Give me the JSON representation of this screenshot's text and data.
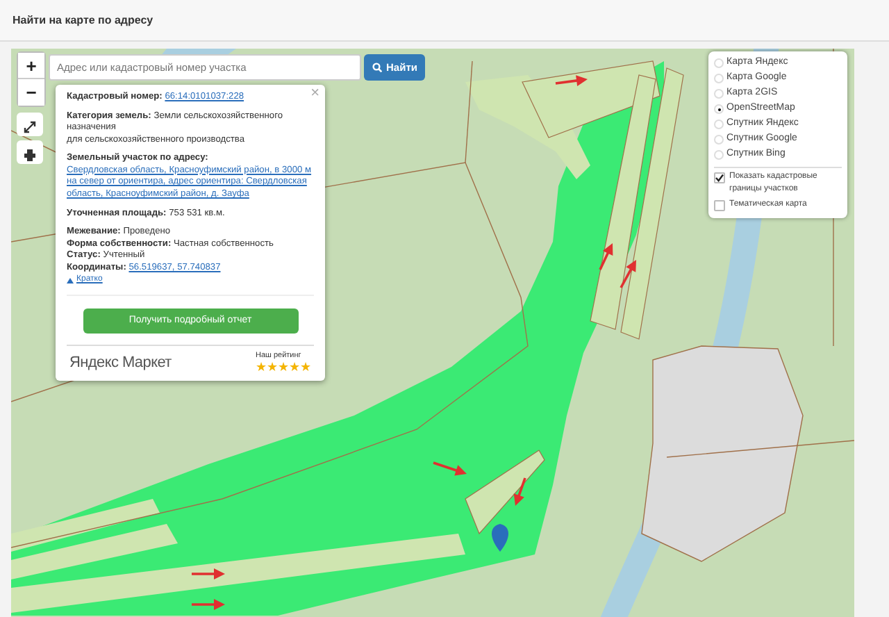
{
  "header": {
    "title": "Найти на карте по адресу"
  },
  "search": {
    "placeholder": "Адрес или кадастровый номер участка",
    "button": "Найти"
  },
  "map_controls": {
    "zoom_in": "+",
    "zoom_out": "−"
  },
  "popup": {
    "close": "×",
    "sections": [
      {
        "fields": [
          {
            "label": "Кадастровый номер:",
            "value": "66:14:0101037:228",
            "kind": "link"
          }
        ]
      },
      {
        "fields": [
          {
            "label": "Категория земель:",
            "value": "Земли сельскохозяйственного назначения\nдля сельскохозяйственного производства",
            "kind": "text"
          }
        ]
      },
      {
        "fields": [
          {
            "label": "Земельный участок по адресу:",
            "value": "Свердловская область, Красноуфимский район, в 3000 м на север от ориентира, адрес ориентира: Свердловская область, Красноуфимский район, д. Зауфа",
            "kind": "link"
          }
        ]
      },
      {
        "fields": [
          {
            "label": "Уточненная площадь:",
            "value": "753 531 кв.м.",
            "kind": "text"
          }
        ]
      },
      {
        "fields": [
          {
            "label": "Межевание:",
            "value": "Проведено",
            "kind": "text"
          },
          {
            "label": "Форма собственности:",
            "value": "Частная собственность",
            "kind": "text"
          },
          {
            "label": "Статус:",
            "value": "Учтенный",
            "kind": "text"
          },
          {
            "label": "Координаты:",
            "value": "56.519637, 57.740837",
            "kind": "link"
          }
        ]
      }
    ],
    "toggle": "Кратко",
    "expanded": true,
    "report_button": "Получить подробный отчет",
    "ad": {
      "brand": "Яндекс Маркет",
      "rating_label": "Наш рейтинг",
      "stars": 5
    }
  },
  "layers": {
    "base": [
      {
        "label": "Карта Яндекс",
        "selected": false
      },
      {
        "label": "Карта Google",
        "selected": false
      },
      {
        "label": "Карта 2GIS",
        "selected": false
      },
      {
        "label": "OpenStreetMap",
        "selected": true
      },
      {
        "label": "Спутник Яндекс",
        "selected": false
      },
      {
        "label": "Спутник Google",
        "selected": false
      },
      {
        "label": "Спутник Bing",
        "selected": false
      }
    ],
    "overlays": [
      {
        "label": "Показать кадастровые границы участков",
        "checked": true
      },
      {
        "label": "Тематическая карта",
        "checked": false
      }
    ]
  }
}
